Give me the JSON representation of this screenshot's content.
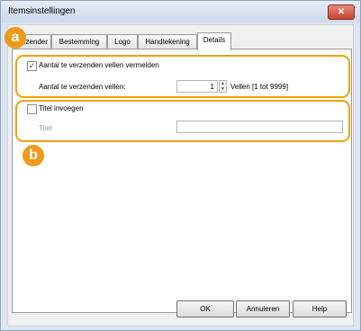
{
  "window": {
    "title": "Itemsinstellingen",
    "close_label": "✕"
  },
  "tabs": [
    {
      "label": "Afzender",
      "active": false
    },
    {
      "label": "Bestemming",
      "active": false
    },
    {
      "label": "Logo",
      "active": false
    },
    {
      "label": "Handtekening",
      "active": false
    },
    {
      "label": "Details",
      "active": true
    }
  ],
  "badges": {
    "a": "a",
    "b": "b"
  },
  "pages": {
    "checkbox_label": "Aantal te verzenden vellen vermelden",
    "checked": true,
    "field_label": "Aantal te verzenden vellen:",
    "value": "1",
    "range_label": "Vellen [1 tot 9999]"
  },
  "title_section": {
    "checkbox_label": "Titel invoegen",
    "checked": false,
    "field_label": "Titel",
    "value": ""
  },
  "buttons": {
    "ok": "OK",
    "cancel": "Annuleren",
    "help": "Help"
  },
  "colors": {
    "accent": "#f0a200",
    "badge": "#ef9a1b"
  }
}
